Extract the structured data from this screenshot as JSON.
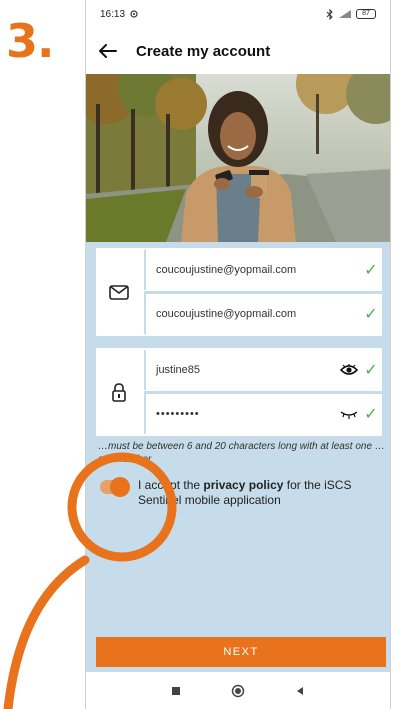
{
  "step": "3.",
  "status_bar": {
    "time": "16:13",
    "battery": "87"
  },
  "app_bar": {
    "title": "Create my account"
  },
  "email": {
    "value": "coucoujustine@yopmail.com",
    "confirm_value": "coucoujustine@yopmail.com"
  },
  "password": {
    "username": "justine85",
    "masked": "•••••••••"
  },
  "hint": "…must be between 6 and 20 characters long with at least one … and number",
  "consent": {
    "prefix": "I accept the ",
    "link": "privacy policy",
    "suffix": " for the iSCS Sentinel mobile application"
  },
  "next_button": "NEXT",
  "colors": {
    "accent": "#e8731c",
    "background": "#c6dcea",
    "check": "#4caf50"
  },
  "icons": {
    "back": "arrow-left-icon",
    "email": "envelope-icon",
    "password": "lock-icon",
    "show_password": "eye-icon",
    "hide_password": "eye-closed-icon",
    "valid": "checkmark-icon",
    "nav_recent": "square-icon",
    "nav_home": "circle-icon",
    "nav_back": "triangle-left-icon"
  }
}
